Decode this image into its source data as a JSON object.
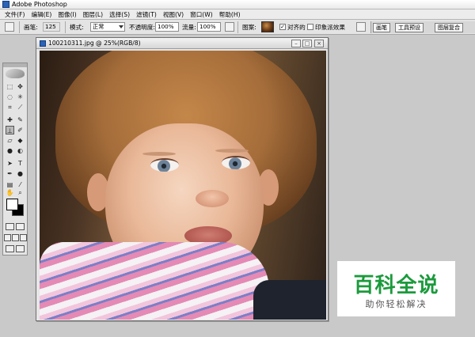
{
  "app": {
    "title": "Adobe Photoshop"
  },
  "menu": {
    "items": [
      "文件(F)",
      "编辑(E)",
      "图像(I)",
      "图层(L)",
      "选择(S)",
      "滤镜(T)",
      "视图(V)",
      "窗口(W)",
      "帮助(H)"
    ]
  },
  "options": {
    "brush_label": "画笔:",
    "brush_size": "125",
    "mode_label": "模式:",
    "mode_value": "正常",
    "opacity_label": "不透明度:",
    "opacity_value": "100%",
    "flow_label": "流量:",
    "flow_value": "100%",
    "pattern_label": "图案:",
    "aligned_label": "对齐的",
    "aligned_checked": "✓",
    "impressionist_label": "印象派效果"
  },
  "palette_tabs": [
    "画笔",
    "工具预设",
    "图层复合"
  ],
  "document": {
    "title": "100210311.jpg @ 25%(RGB/8)",
    "minimize": "–",
    "maximize": "□",
    "close": "×"
  },
  "watermark": {
    "main": "百科全说",
    "sub": "助你轻松解决"
  }
}
